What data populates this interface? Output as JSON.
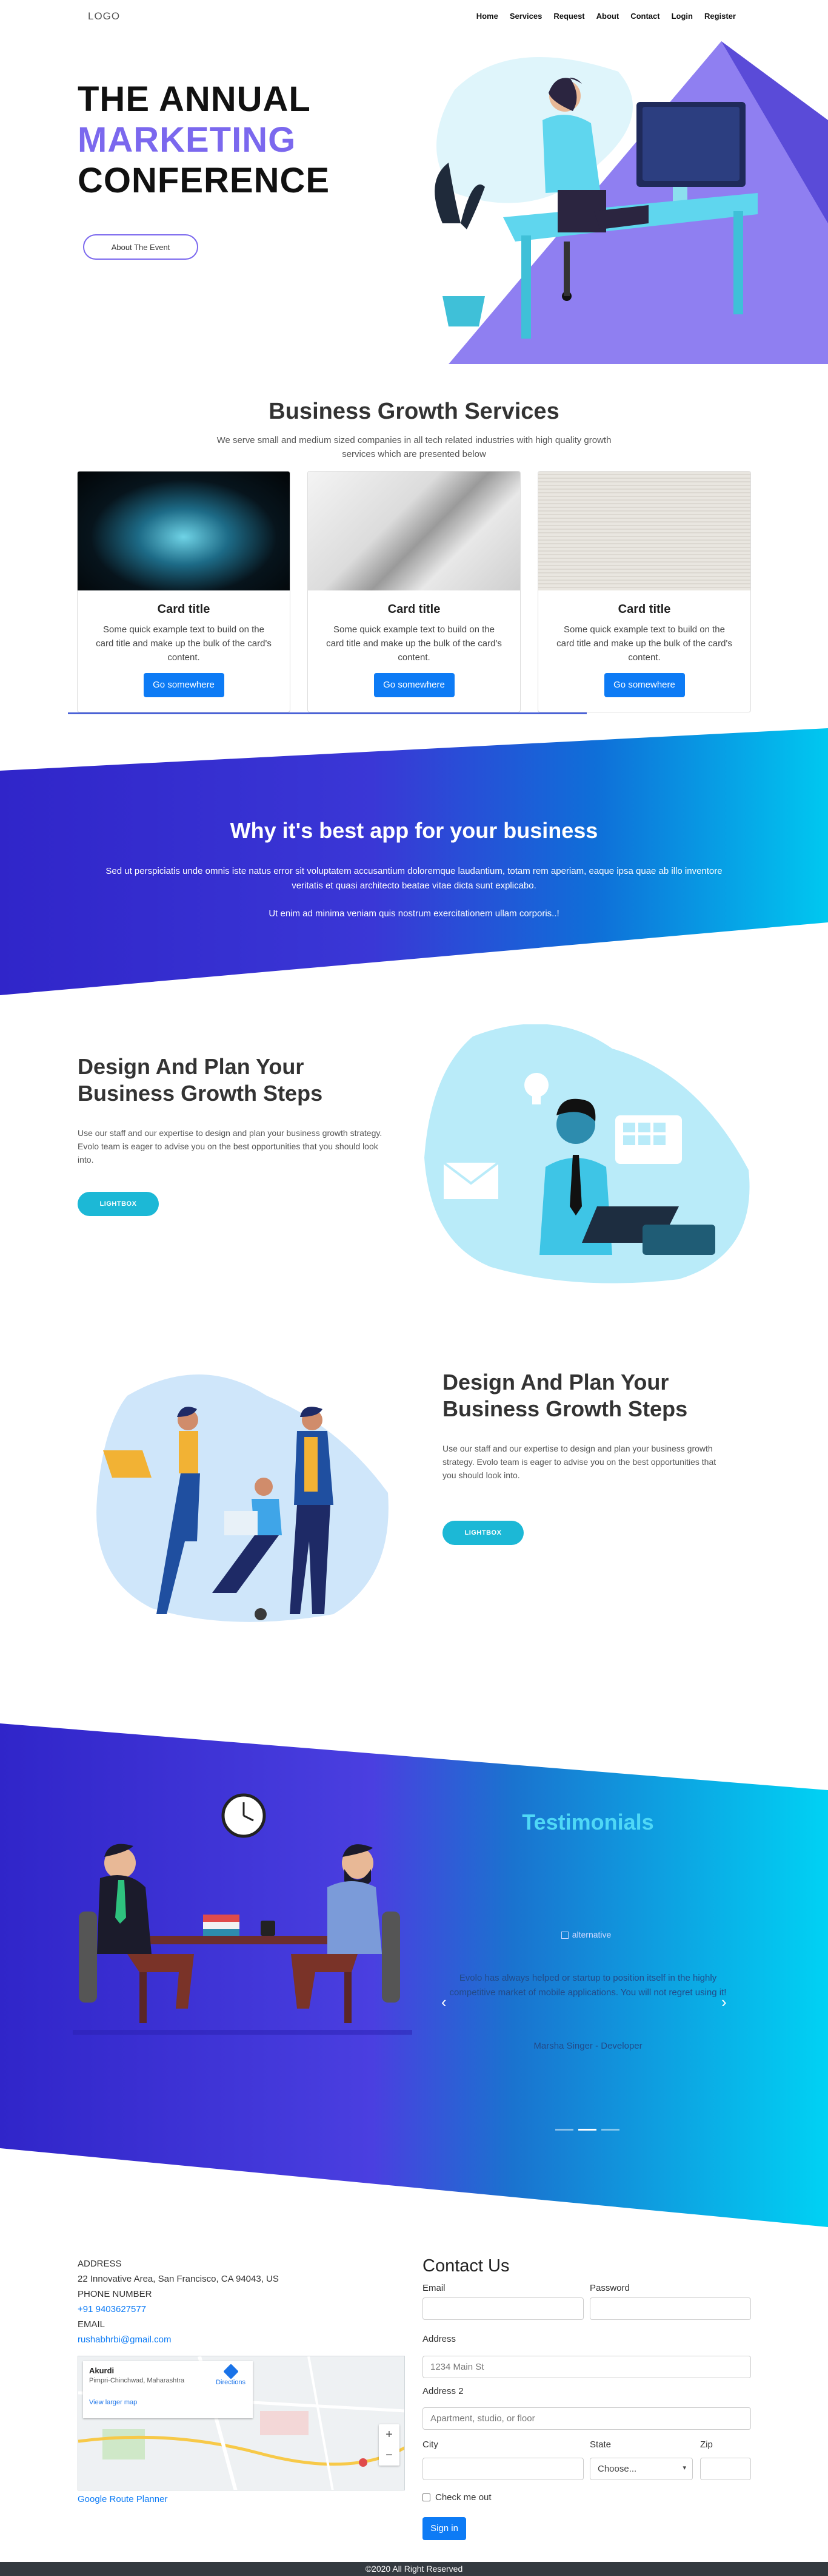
{
  "nav": {
    "logo": "LOGO",
    "links": [
      "Home",
      "Services",
      "Request",
      "About",
      "Contact",
      "Login",
      "Register"
    ]
  },
  "hero": {
    "line1": "THE ANNUAL",
    "line2": "MARKETING",
    "line3": "CONFERENCE",
    "button": "About The Event"
  },
  "services": {
    "title": "Business Growth Services",
    "subtitle": "We serve small and medium sized companies in all tech related industries with high quality growth services which are presented below",
    "cards": [
      {
        "title": "Card title",
        "text": "Some quick example text to build on the card title and make up the bulk of the card's content.",
        "button": "Go somewhere"
      },
      {
        "title": "Card title",
        "text": "Some quick example text to build on the card title and make up the bulk of the card's content.",
        "button": "Go somewhere"
      },
      {
        "title": "Card title",
        "text": "Some quick example text to build on the card title and make up the bulk of the card's content.",
        "button": "Go somewhere"
      }
    ]
  },
  "band": {
    "title": "Why it's best app for your business",
    "para1": "Sed ut perspiciatis unde omnis iste natus error sit voluptatem accusantium doloremque laudantium, totam rem aperiam, eaque ipsa quae ab illo inventore veritatis et quasi architecto beatae vitae dicta sunt explicabo.",
    "para2": "Ut enim ad minima veniam quis nostrum exercitationem ullam corporis..!"
  },
  "design1": {
    "title": "Design And Plan Your Business Growth Steps",
    "text": "Use our staff and our expertise to design and plan your business growth strategy. Evolo team is eager to advise you on the best opportunities that you should look into.",
    "button": "LIGHTBOX"
  },
  "design2": {
    "title": "Design And Plan Your Business Growth Steps",
    "text": "Use our staff and our expertise to design and plan your business growth strategy. Evolo team is eager to advise you on the best opportunities that you should look into.",
    "button": "LIGHTBOX"
  },
  "testimonials": {
    "title": "Testimonials",
    "img_alt": "alternative",
    "quote": "Evolo has always helped or startup to position itself in the highly competitive market of mobile applications. You will not regret using it!",
    "author": "Marsha Singer - Developer"
  },
  "contact_info": {
    "address_label": "ADDRESS",
    "address": "22 Innovative Area, San Francisco, CA 94043, US",
    "phone_label": "PHONE NUMBER",
    "phone": "+91 9403627577",
    "email_label": "EMAIL",
    "email": "rushabhrbi@gmail.com",
    "map_place": "Akurdi",
    "map_region": "Pimpri-Chinchwad, Maharashtra",
    "map_directions": "Directions",
    "map_larger": "View larger map",
    "route_link": "Google Route Planner"
  },
  "form": {
    "title": "Contact Us",
    "email_label": "Email",
    "password_label": "Password",
    "address_label": "Address",
    "address_placeholder": "1234 Main St",
    "address2_label": "Address 2",
    "address2_placeholder": "Apartment, studio, or floor",
    "city_label": "City",
    "state_label": "State",
    "state_value": "Choose...",
    "zip_label": "Zip",
    "checkbox_label": "Check me out",
    "submit": "Sign in"
  },
  "footer": {
    "text": "©2020 All Right Reserved"
  },
  "colors": {
    "accent": "#7b68ee",
    "primary": "#0d7bf5",
    "band_start": "#3025c9",
    "band_end": "#00c8f0",
    "cyan_button": "#1cb8d6"
  }
}
